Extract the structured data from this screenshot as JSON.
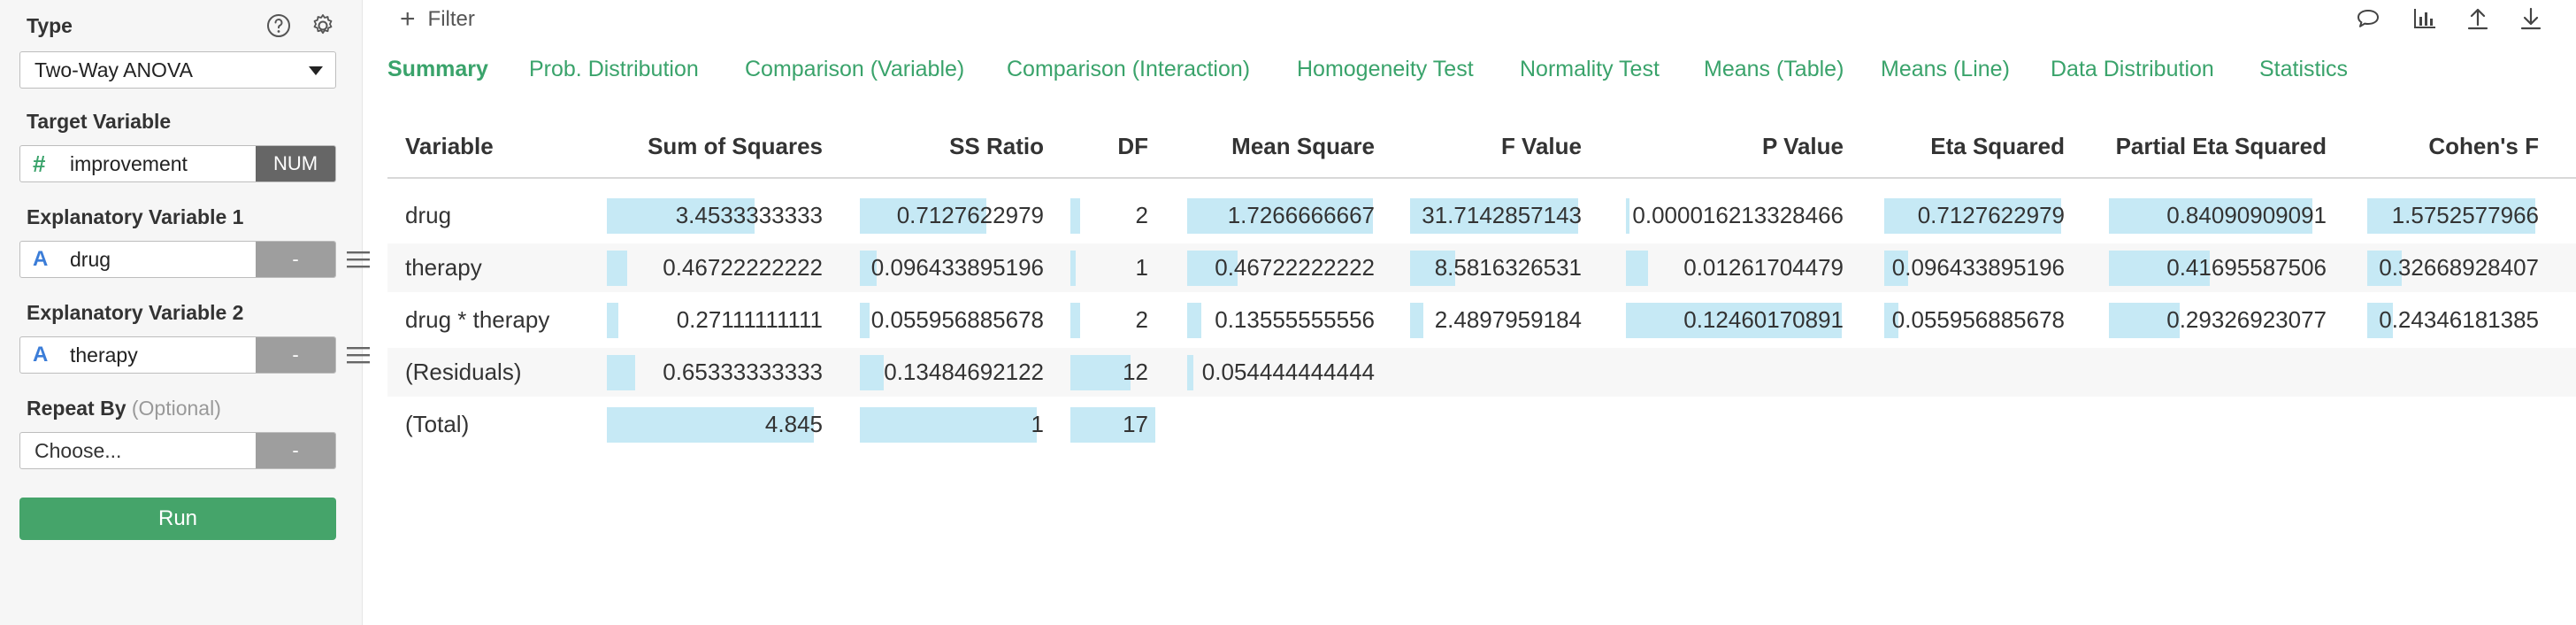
{
  "left_panel": {
    "type": {
      "label": "Type",
      "help_icon": "question-circle-icon",
      "settings_icon": "gear-icon",
      "selected": "Two-Way ANOVA"
    },
    "target_variable": {
      "label": "Target Variable",
      "type_icon": "#",
      "name": "improvement",
      "tag": "NUM"
    },
    "explanatory_1": {
      "label": "Explanatory Variable 1",
      "type_icon": "A",
      "name": "drug",
      "tag": "-"
    },
    "explanatory_2": {
      "label": "Explanatory Variable 2",
      "type_icon": "A",
      "name": "therapy",
      "tag": "-"
    },
    "repeat_by": {
      "label": "Repeat By",
      "optional": "(Optional)",
      "placeholder": "Choose...",
      "tag": "-"
    },
    "run_label": "Run"
  },
  "toolbar": {
    "filter_label": "Filter",
    "icons": [
      "comment-icon",
      "bar-chart-icon",
      "upload-icon",
      "download-icon"
    ]
  },
  "tabs": [
    {
      "label": "Summary",
      "active": true
    },
    {
      "label": "Prob. Distribution",
      "active": false
    },
    {
      "label": "Comparison (Variable)",
      "active": false
    },
    {
      "label": "Comparison (Interaction)",
      "active": false
    },
    {
      "label": "Homogeneity Test",
      "active": false
    },
    {
      "label": "Normality Test",
      "active": false
    },
    {
      "label": "Means (Table)",
      "active": false
    },
    {
      "label": "Means (Line)",
      "active": false
    },
    {
      "label": "Data Distribution",
      "active": false
    },
    {
      "label": "Statistics",
      "active": false
    }
  ],
  "table": {
    "columns": [
      "Variable",
      "Sum of Squares",
      "SS Ratio",
      "DF",
      "Mean Square",
      "F Value",
      "P Value",
      "Eta Squared",
      "Partial Eta Squared",
      "Cohen's F"
    ],
    "rows": [
      [
        "drug",
        "3.4533333333",
        "0.7127622979",
        "2",
        "1.7266666667",
        "31.7142857143",
        "0.000016213328466",
        "0.7127622979",
        "0.84090909091",
        "1.5752577966"
      ],
      [
        "therapy",
        "0.46722222222",
        "0.096433895196",
        "1",
        "0.46722222222",
        "8.5816326531",
        "0.01261704479",
        "0.096433895196",
        "0.41695587506",
        "0.32668928407"
      ],
      [
        "drug * therapy",
        "0.27111111111",
        "0.055956885678",
        "2",
        "0.13555555556",
        "2.4897959184",
        "0.12460170891",
        "0.055956885678",
        "0.29326923077",
        "0.24346181385"
      ],
      [
        "(Residuals)",
        "0.65333333333",
        "0.13484692122",
        "12",
        "0.054444444444",
        "",
        "",
        "",
        "",
        ""
      ],
      [
        "(Total)",
        "4.845",
        "1",
        "17",
        "",
        "",
        "",
        "",
        "",
        ""
      ]
    ],
    "bar_color": "#c6e9f5"
  },
  "colors": {
    "accent_green": "#3aa36b",
    "run_button": "#45a46a",
    "num_tag": "#666666",
    "str_tag": "#9e9e9e"
  }
}
